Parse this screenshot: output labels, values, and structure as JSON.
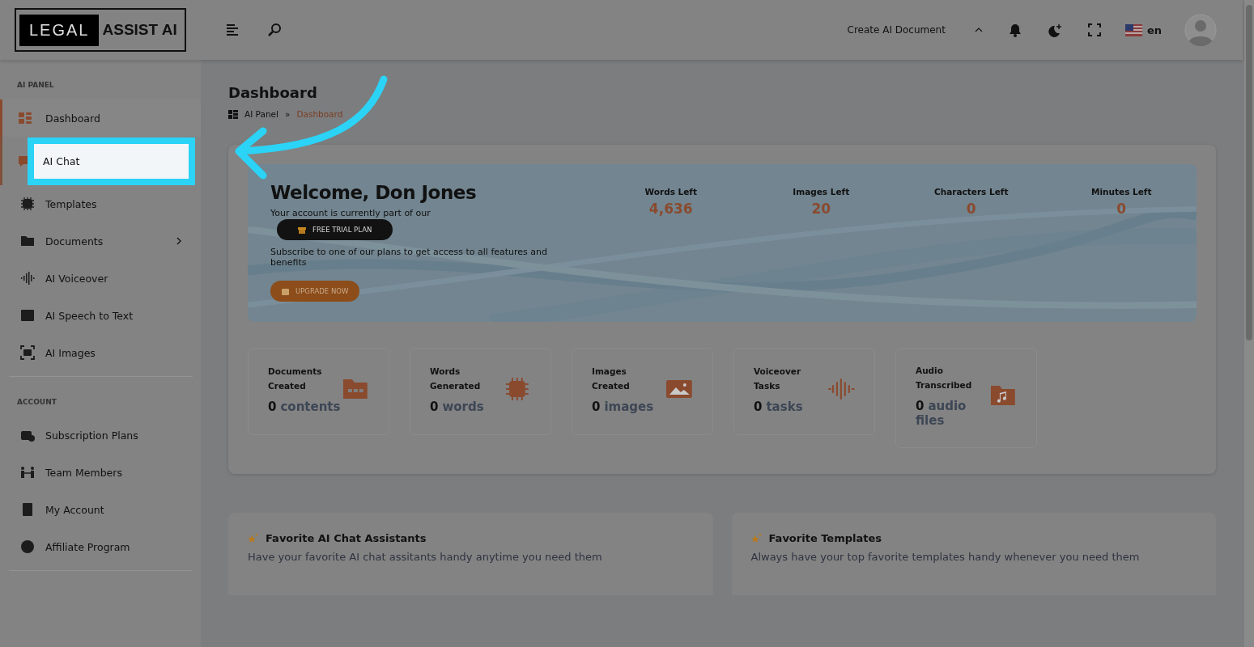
{
  "header": {
    "logo": {
      "boxed": "LEGAL",
      "plain": "ASSIST AI"
    },
    "create_button": "Create AI Document",
    "language": "en"
  },
  "sidebar": [
    {
      "title": "AI PANEL",
      "items": [
        {
          "label": "Dashboard",
          "selected": true,
          "highlighted": false,
          "submenu": false
        },
        {
          "label": "AI Chat",
          "selected": false,
          "highlighted": true,
          "submenu": false
        },
        {
          "label": "Templates",
          "selected": false,
          "highlighted": false,
          "submenu": false
        },
        {
          "label": "Documents",
          "selected": false,
          "highlighted": false,
          "submenu": true
        },
        {
          "label": "AI Voiceover",
          "selected": false,
          "highlighted": false,
          "submenu": false
        },
        {
          "label": "AI Speech to Text",
          "selected": false,
          "highlighted": false,
          "submenu": false
        },
        {
          "label": "AI Images",
          "selected": false,
          "highlighted": false,
          "submenu": false
        }
      ]
    },
    {
      "title": "ACCOUNT",
      "items": [
        {
          "label": "Subscription Plans",
          "selected": false,
          "highlighted": false,
          "submenu": false
        },
        {
          "label": "Team Members",
          "selected": false,
          "highlighted": false,
          "submenu": false
        },
        {
          "label": "My Account",
          "selected": false,
          "highlighted": false,
          "submenu": false
        },
        {
          "label": "Affiliate Program",
          "selected": false,
          "highlighted": false,
          "submenu": false
        }
      ]
    }
  ],
  "page_title": "Dashboard",
  "breadcrumb": [
    "AI Panel",
    "Dashboard"
  ],
  "breadcrumb_separator": "»",
  "welcome": {
    "title": "Welcome, Don Jones",
    "plan_intro": "Your account is currently part of our",
    "plan": "FREE TRIAL PLAN",
    "subscribe_text": "Subscribe to one of our plans to get access to all features and benefits",
    "upgrade_button": "UPGRADE NOW"
  },
  "quotas": [
    {
      "label": "Words Left",
      "value": "4,636"
    },
    {
      "label": "Images Left",
      "value": "20"
    },
    {
      "label": "Characters Left",
      "value": "0"
    },
    {
      "label": "Minutes Left",
      "value": "0"
    }
  ],
  "stat_cards": [
    {
      "title": "Documents Created",
      "count": "0",
      "unit": "contents"
    },
    {
      "title": "Words Generated",
      "count": "0",
      "unit": "words"
    },
    {
      "title": "Images Created",
      "count": "0",
      "unit": "images"
    },
    {
      "title": "Voiceover Tasks",
      "count": "0",
      "unit": "tasks"
    },
    {
      "title": "Audio Transcribed",
      "count": "0",
      "unit": "audio files"
    }
  ],
  "favorites": [
    {
      "title": "Favorite AI Chat Assistants",
      "description": "Have your favorite AI chat assitants handy anytime you need them"
    },
    {
      "title": "Favorite Templates",
      "description": "Always have your top favorite templates handy whenever you need them"
    }
  ]
}
